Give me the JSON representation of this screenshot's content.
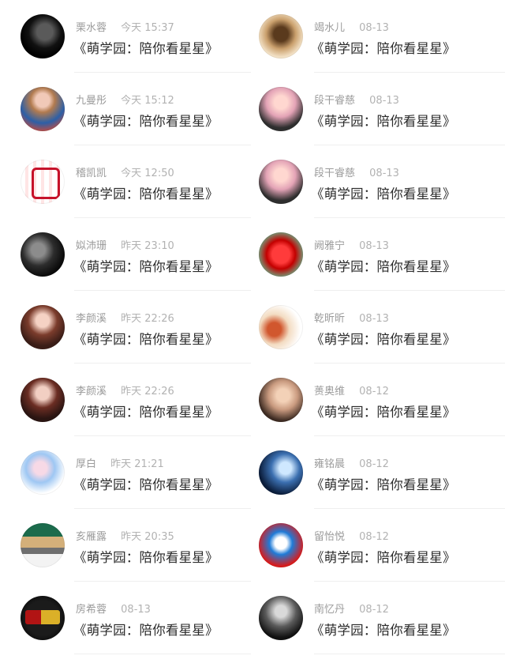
{
  "left_items": [
    {
      "name": "栗水蓉",
      "time": "今天 15:37",
      "message": "《萌学园：陪你看星星》",
      "avatar_icon": "avatar-image"
    },
    {
      "name": "九曼彤",
      "time": "今天 15:12",
      "message": "《萌学园：陪你看星星》",
      "avatar_icon": "avatar-image"
    },
    {
      "name": "稽凯凯",
      "time": "今天 12:50",
      "message": "《萌学园：陪你看星星》",
      "avatar_icon": "avatar-image"
    },
    {
      "name": "姒沛珊",
      "time": "昨天 23:10",
      "message": "《萌学园：陪你看星星》",
      "avatar_icon": "avatar-image"
    },
    {
      "name": "李颜溪",
      "time": "昨天 22:26",
      "message": "《萌学园：陪你看星星》",
      "avatar_icon": "avatar-image"
    },
    {
      "name": "李颜溪",
      "time": "昨天 22:26",
      "message": "《萌学园：陪你看星星》",
      "avatar_icon": "avatar-image"
    },
    {
      "name": "厚白",
      "time": "昨天 21:21",
      "message": "《萌学园：陪你看星星》",
      "avatar_icon": "avatar-image"
    },
    {
      "name": "亥雁露",
      "time": "昨天 20:35",
      "message": "《萌学园：陪你看星星》",
      "avatar_icon": "avatar-image"
    },
    {
      "name": "房希蓉",
      "time": "08-13",
      "message": "《萌学园：陪你看星星》",
      "avatar_icon": "avatar-image"
    }
  ],
  "right_items": [
    {
      "name": "竭水儿",
      "time": "08-13",
      "message": "《萌学园：陪你看星星》",
      "avatar_icon": "avatar-image"
    },
    {
      "name": "段干睿慈",
      "time": "08-13",
      "message": "《萌学园：陪你看星星》",
      "avatar_icon": "avatar-image"
    },
    {
      "name": "段干睿慈",
      "time": "08-13",
      "message": "《萌学园：陪你看星星》",
      "avatar_icon": "avatar-image"
    },
    {
      "name": "阙雅宁",
      "time": "08-13",
      "message": "《萌学园：陪你看星星》",
      "avatar_icon": "avatar-image"
    },
    {
      "name": "乾昕昕",
      "time": "08-13",
      "message": "《萌学园：陪你看星星》",
      "avatar_icon": "avatar-image"
    },
    {
      "name": "蒉奥维",
      "time": "08-12",
      "message": "《萌学园：陪你看星星》",
      "avatar_icon": "avatar-image"
    },
    {
      "name": "雍铭晨",
      "time": "08-12",
      "message": "《萌学园：陪你看星星》",
      "avatar_icon": "avatar-image"
    },
    {
      "name": "留怡悦",
      "time": "08-12",
      "message": "《萌学园：陪你看星星》",
      "avatar_icon": "avatar-image"
    },
    {
      "name": "南忆丹",
      "time": "08-12",
      "message": "《萌学园：陪你看星星》",
      "avatar_icon": "avatar-image"
    }
  ]
}
